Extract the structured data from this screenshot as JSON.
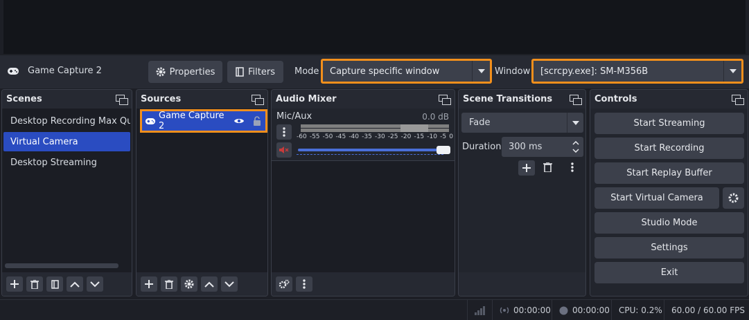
{
  "context": {
    "source_name": "Game Capture 2",
    "properties_label": "Properties",
    "filters_label": "Filters",
    "mode_label": "Mode",
    "mode_value": "Capture specific window",
    "window_label": "Window",
    "window_value": "[scrcpy.exe]: SM-M356B"
  },
  "scenes": {
    "title": "Scenes",
    "items": [
      {
        "label": "Desktop Recording Max Quality",
        "active": false
      },
      {
        "label": "Virtual Camera",
        "active": true
      },
      {
        "label": "Desktop Streaming",
        "active": false
      }
    ]
  },
  "sources": {
    "title": "Sources",
    "items": [
      {
        "label": "Game Capture 2"
      }
    ]
  },
  "mixer": {
    "title": "Audio Mixer",
    "channel": "Mic/Aux",
    "level": "0.0 dB",
    "ticks": [
      "-60",
      "-55",
      "-50",
      "-45",
      "-40",
      "-35",
      "-30",
      "-25",
      "-20",
      "-15",
      "-10",
      "-5",
      "0"
    ],
    "volume": 1.0
  },
  "transitions": {
    "title": "Scene Transitions",
    "selected": "Fade",
    "duration_label": "Duration",
    "duration_value": "300 ms"
  },
  "controls": {
    "title": "Controls",
    "start_streaming": "Start Streaming",
    "start_recording": "Start Recording",
    "start_replay": "Start Replay Buffer",
    "start_virtual_camera": "Start Virtual Camera",
    "studio_mode": "Studio Mode",
    "settings": "Settings",
    "exit": "Exit"
  },
  "status": {
    "stream_time": "00:00:00",
    "record_time": "00:00:00",
    "cpu": "CPU: 0.2%",
    "fps": "60.00 / 60.00 FPS"
  },
  "colors": {
    "accent": "#2a4cc1",
    "highlight": "#f28f1c",
    "mute": "#c63b3b",
    "meter": "#7f7f7f"
  }
}
